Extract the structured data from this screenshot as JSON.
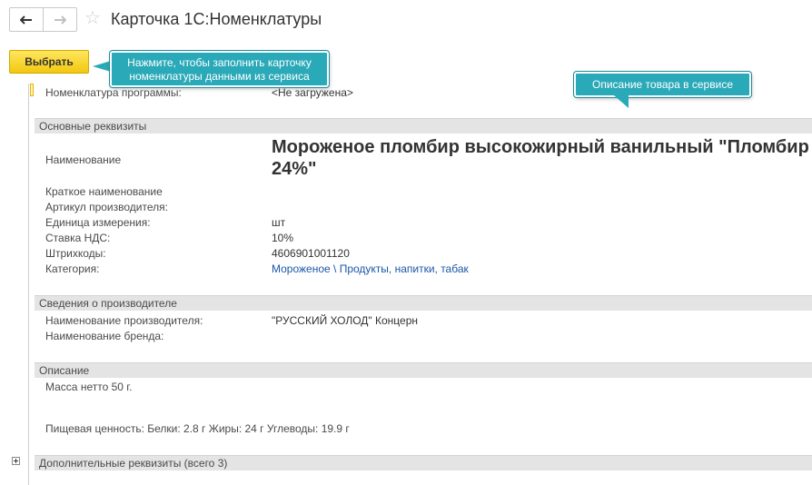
{
  "window": {
    "title": "Карточка 1С:Номенклатуры",
    "back_icon": "arrow-left-icon",
    "forward_icon": "arrow-right-icon",
    "favorite_icon": "star-icon"
  },
  "toolbar": {
    "select_label": "Выбрать"
  },
  "callouts": {
    "fill_card": "Нажмите, чтобы заполнить карточку номенклатуры данными из сервиса",
    "description": "Описание товара в сервисе"
  },
  "program_item": {
    "label": "Номенклатура программы:",
    "value": "<Не загружена>"
  },
  "main": {
    "header": "Основные реквизиты",
    "name_label": "Наименование",
    "name_value": "Мороженое пломбир высокожирный ванильный \"Пломбир 24%\"",
    "short_name_label": "Краткое наименование",
    "short_name_value": "",
    "article_label": "Артикул производителя:",
    "article_value": "",
    "unit_label": "Единица измерения:",
    "unit_value": "шт",
    "vat_label": "Ставка НДС:",
    "vat_value": "10%",
    "barcodes_label": "Штрихкоды:",
    "barcodes_value": "4606901001120",
    "category_label": "Категория:",
    "category_value": "Мороженое \\ Продукты, напитки, табак"
  },
  "manufacturer": {
    "header": "Сведения о производителе",
    "name_label": "Наименование производителя:",
    "name_value": "\"РУССКИЙ ХОЛОД\" Концерн",
    "brand_label": "Наименование бренда:",
    "brand_value": ""
  },
  "description": {
    "header": "Описание",
    "line1": "Масса нетто 50 г.",
    "line2": "Пищевая ценность: Белки: 2.8 г Жиры: 24 г Углеводы: 19.9 г"
  },
  "additional": {
    "header": "Дополнительные реквизиты (всего 3)"
  },
  "colors": {
    "accent_button": "#f2c80e",
    "callout": "#2aa9b8",
    "link": "#1a56a8",
    "section_bg": "#e4e4e4"
  }
}
